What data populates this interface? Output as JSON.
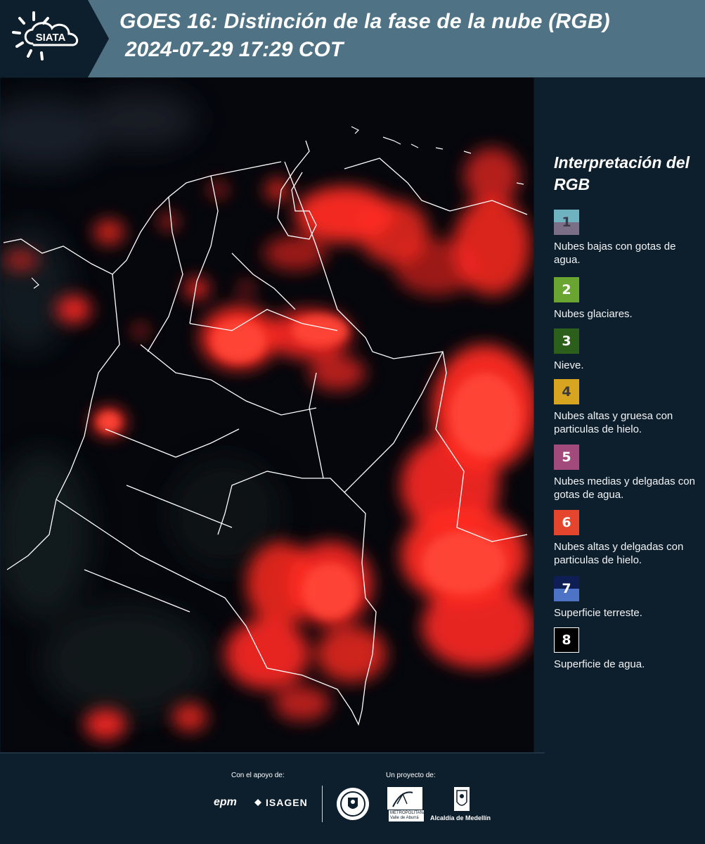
{
  "header": {
    "logo_text": "SIATA",
    "title_line1": "GOES 16: Distinción de la fase de la nube (RGB)",
    "title_line2": "2024-07-29 17:29 COT"
  },
  "map": {
    "description_icon": "satellite-map",
    "colors": {
      "cloud": "#ff3b2e",
      "background": "#05070c",
      "border": "#ffffff"
    }
  },
  "legend": {
    "title": "Interpretación del RGB",
    "items": [
      {
        "number": "1",
        "label": "Nubes bajas con gotas de agua.",
        "color_top": "#6fb3c1",
        "color_bottom": "#7a6f86",
        "text_color": "#3c3a48"
      },
      {
        "number": "2",
        "label": "Nubes glaciares.",
        "color": "#6aa531",
        "text_color": "#ffffff"
      },
      {
        "number": "3",
        "label": "Nieve.",
        "color": "#2c5e1c",
        "text_color": "#ffffff"
      },
      {
        "number": "4",
        "label": "Nubes altas y gruesa con particulas de hielo.",
        "color": "#d8a520",
        "text_color": "#3a3a3a"
      },
      {
        "number": "5",
        "label": "Nubes medias y delgadas con gotas de agua.",
        "color": "#a24a7c",
        "text_color": "#ffffff"
      },
      {
        "number": "6",
        "label": "Nubes altas y delgadas con particulas de hielo.",
        "color": "#e4452c",
        "text_color": "#ffffff"
      },
      {
        "number": "7",
        "label": "Superficie terreste.",
        "color_top": "#0f1d55",
        "color_bottom": "#4d73c6",
        "text_color": "#ffffff"
      },
      {
        "number": "8",
        "label": "Superficie de agua.",
        "color": "#000000",
        "text_color": "#ffffff"
      }
    ]
  },
  "footer": {
    "support_label": "Con el apoyo de:",
    "project_label": "Un proyecto de:",
    "epm": "epm",
    "isagen": "ISAGEN",
    "area_metro": "METROPOLITANA",
    "area_sub": "Valle de Aburrá",
    "alcaldia": "Alcaldía de Medellín"
  }
}
